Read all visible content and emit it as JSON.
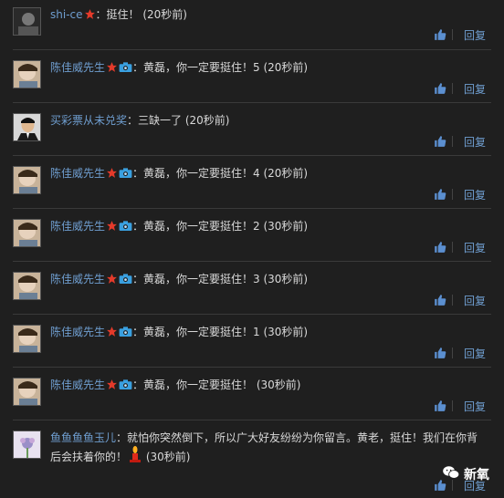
{
  "comments": [
    {
      "user": "shi-ce",
      "badges": [
        "star"
      ],
      "text": "：挺住！ (20秒前)",
      "avatar": "dark-portrait"
    },
    {
      "user": "陈佳威先生",
      "badges": [
        "star",
        "camera"
      ],
      "text": "：黄磊，你一定要挺住！5 (20秒前)",
      "avatar": "boy"
    },
    {
      "user": "买彩票从未兑奖",
      "badges": [],
      "text": "：三缺一了 (20秒前)",
      "avatar": "man-suit"
    },
    {
      "user": "陈佳威先生",
      "badges": [
        "star",
        "camera"
      ],
      "text": "：黄磊，你一定要挺住！4 (20秒前)",
      "avatar": "boy"
    },
    {
      "user": "陈佳威先生",
      "badges": [
        "star",
        "camera"
      ],
      "text": "：黄磊，你一定要挺住！2 (30秒前)",
      "avatar": "boy"
    },
    {
      "user": "陈佳威先生",
      "badges": [
        "star",
        "camera"
      ],
      "text": "：黄磊，你一定要挺住！3 (30秒前)",
      "avatar": "boy"
    },
    {
      "user": "陈佳威先生",
      "badges": [
        "star",
        "camera"
      ],
      "text": "：黄磊，你一定要挺住！1 (30秒前)",
      "avatar": "boy"
    },
    {
      "user": "陈佳威先生",
      "badges": [
        "star",
        "camera"
      ],
      "text": "：黄磊，你一定要挺住！ (30秒前)",
      "avatar": "boy"
    },
    {
      "user": "鱼鱼鱼鱼玉儿",
      "badges": [],
      "text_a": "：就怕你突然倒下，所以广大好友纷纷为你留言。黄老，挺住！我们在你背后会扶着你的！",
      "text_b": " (30秒前)",
      "avatar": "flower"
    }
  ],
  "reply_label": "回复",
  "watermark": "新氧",
  "colors": {
    "background": "#1f1f1f",
    "username": "#6f9ed0",
    "text": "#d8d8d8",
    "like": "#5b8fd0",
    "star": "#e33a2a",
    "camera": "#3aa0e0"
  }
}
